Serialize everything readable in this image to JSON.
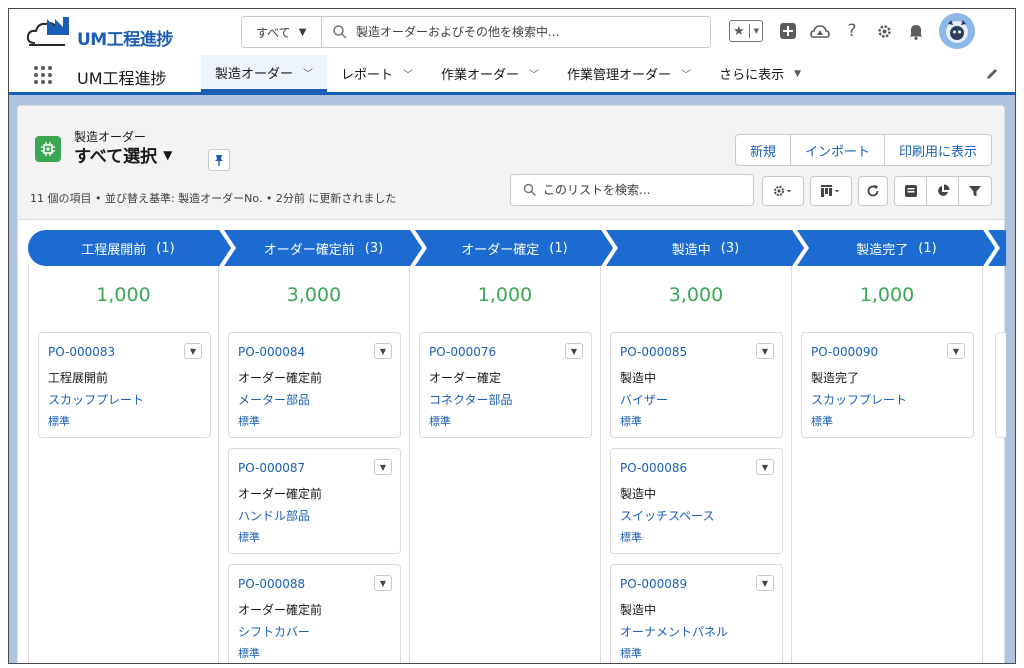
{
  "header": {
    "logo_text": "UM工程進捗",
    "search_scope": "すべて",
    "search_placeholder": "製造オーダーおよびその他を検索中..."
  },
  "nav": {
    "app_name": "UM工程進捗",
    "tabs": [
      {
        "label": "製造オーダー",
        "active": true
      },
      {
        "label": "レポート"
      },
      {
        "label": "作業オーダー"
      },
      {
        "label": "作業管理オーダー"
      }
    ],
    "more_label": "さらに表示"
  },
  "list": {
    "object_label": "製造オーダー",
    "view_name": "すべて選択",
    "meta": "11 個の項目 • 並び替え基準: 製造オーダーNo. • 2分前 に更新されました",
    "buttons": {
      "new": "新規",
      "import": "インポート",
      "print": "印刷用に表示"
    },
    "search_placeholder": "このリストを検索..."
  },
  "path": [
    {
      "label": "工程展開前",
      "count": "(1)"
    },
    {
      "label": "オーダー確定前",
      "count": "(3)"
    },
    {
      "label": "オーダー確定",
      "count": "(1)"
    },
    {
      "label": "製造中",
      "count": "(3)"
    },
    {
      "label": "製造完了",
      "count": "(1)"
    }
  ],
  "columns": [
    {
      "sum": "1,000",
      "cards": [
        {
          "po": "PO-000083",
          "status": "工程展開前",
          "part": "スカッフプレート",
          "type": "標準"
        }
      ]
    },
    {
      "sum": "3,000",
      "cards": [
        {
          "po": "PO-000084",
          "status": "オーダー確定前",
          "part": "メーター部品",
          "type": "標準"
        },
        {
          "po": "PO-000087",
          "status": "オーダー確定前",
          "part": "ハンドル部品",
          "type": "標準"
        },
        {
          "po": "PO-000088",
          "status": "オーダー確定前",
          "part": "シフトカバー",
          "type": "標準"
        }
      ]
    },
    {
      "sum": "1,000",
      "cards": [
        {
          "po": "PO-000076",
          "status": "オーダー確定",
          "part": "コネクター部品",
          "type": "標準"
        }
      ]
    },
    {
      "sum": "3,000",
      "cards": [
        {
          "po": "PO-000085",
          "status": "製造中",
          "part": "バイザー",
          "type": "標準"
        },
        {
          "po": "PO-000086",
          "status": "製造中",
          "part": "スイッチスペース",
          "type": "標準"
        },
        {
          "po": "PO-000089",
          "status": "製造中",
          "part": "オーナメントパネル",
          "type": "標準"
        }
      ]
    },
    {
      "sum": "1,000",
      "cards": [
        {
          "po": "PO-000090",
          "status": "製造完了",
          "part": "スカッフプレート",
          "type": "標準"
        }
      ]
    }
  ],
  "colors": {
    "brand": "#1b5fb4",
    "path": "#1b6bd1",
    "sum": "#3ba755"
  }
}
